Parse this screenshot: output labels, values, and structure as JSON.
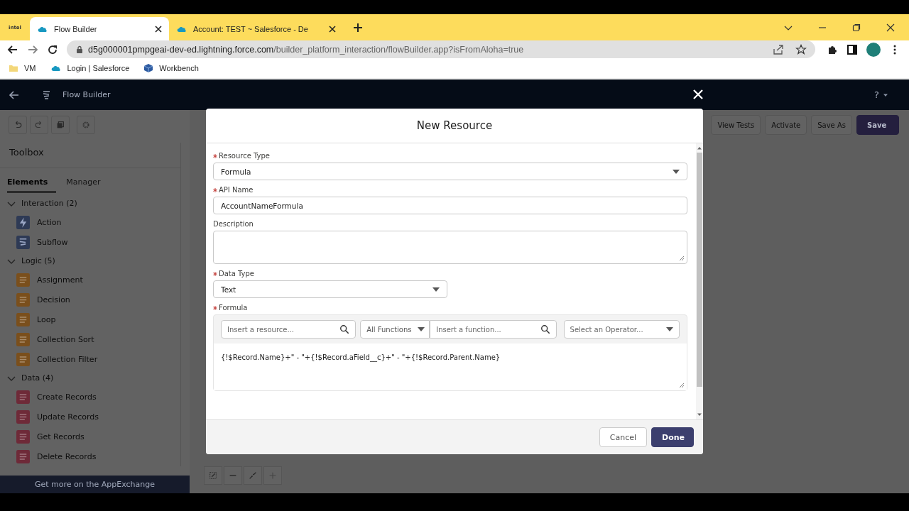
{
  "browser": {
    "brand": "intel",
    "tabs": [
      {
        "title": "Flow Builder",
        "selected": true
      },
      {
        "title": "Account: TEST ~ Salesforce - De",
        "selected": false
      }
    ],
    "address": {
      "domain": "d5g000001pmpgeai-dev-ed.lightning.force.com",
      "path": "/builder_platform_interaction/flowBuilder.app?isFromAloha=true"
    },
    "bookmarks": [
      {
        "label": "VM",
        "kind": "folder"
      },
      {
        "label": "Login | Salesforce",
        "kind": "cloud"
      },
      {
        "label": "Workbench",
        "kind": "cube"
      }
    ]
  },
  "app": {
    "title": "Flow Builder",
    "help": "?",
    "toolbar_buttons": [
      {
        "label": "View Tests",
        "kind": "neutral"
      },
      {
        "label": "Activate",
        "kind": "neutral"
      },
      {
        "label": "Save As",
        "kind": "neutral"
      },
      {
        "label": "Save",
        "kind": "brand"
      }
    ]
  },
  "toolbox": {
    "title": "Toolbox",
    "tabs": [
      {
        "label": "Elements",
        "selected": true
      },
      {
        "label": "Manager",
        "selected": false
      }
    ],
    "sections": [
      {
        "label": "Interaction (2)",
        "expanded": true,
        "items": [
          {
            "label": "Action",
            "color": "#2e3a55"
          },
          {
            "label": "Subflow",
            "color": "#2e3a55"
          }
        ]
      },
      {
        "label": "Logic (5)",
        "expanded": true,
        "items": [
          {
            "label": "Assignment",
            "color": "#7a4f1c"
          },
          {
            "label": "Decision",
            "color": "#7a4f1c"
          },
          {
            "label": "Loop",
            "color": "#7a4f1c"
          },
          {
            "label": "Collection Sort",
            "color": "#7a4f1c"
          },
          {
            "label": "Collection Filter",
            "color": "#7a4f1c"
          }
        ]
      },
      {
        "label": "Data (4)",
        "expanded": true,
        "items": [
          {
            "label": "Create Records",
            "color": "#6e2a38"
          },
          {
            "label": "Update Records",
            "color": "#6e2a38"
          },
          {
            "label": "Get Records",
            "color": "#6e2a38"
          },
          {
            "label": "Delete Records",
            "color": "#6e2a38"
          }
        ]
      }
    ],
    "footer_link": "Get more on the AppExchange"
  },
  "modal": {
    "title": "New Resource",
    "fields": [
      {
        "kind": "select",
        "label": "Resource Type",
        "required": true,
        "value": "Formula"
      },
      {
        "kind": "text",
        "label": "API Name",
        "required": true,
        "value": "AccountNameFormula"
      },
      {
        "kind": "textarea",
        "label": "Description",
        "required": false
      },
      {
        "kind": "select-narrow",
        "label": "Data Type",
        "required": true,
        "value": "Text"
      }
    ],
    "formula": {
      "label": "Formula",
      "required": true,
      "resource_placeholder": "Insert a resource...",
      "function_category": "All Functions",
      "function_placeholder": "Insert a function...",
      "operator_placeholder": "Select an Operator...",
      "value": "{!$Record.Name}+\" - \"+{!$Record.aField__c}+\" - \"+{!$Record.Parent.Name}"
    },
    "buttons": [
      {
        "label": "Cancel",
        "kind": "neutral"
      },
      {
        "label": "Done",
        "kind": "brand"
      }
    ]
  }
}
